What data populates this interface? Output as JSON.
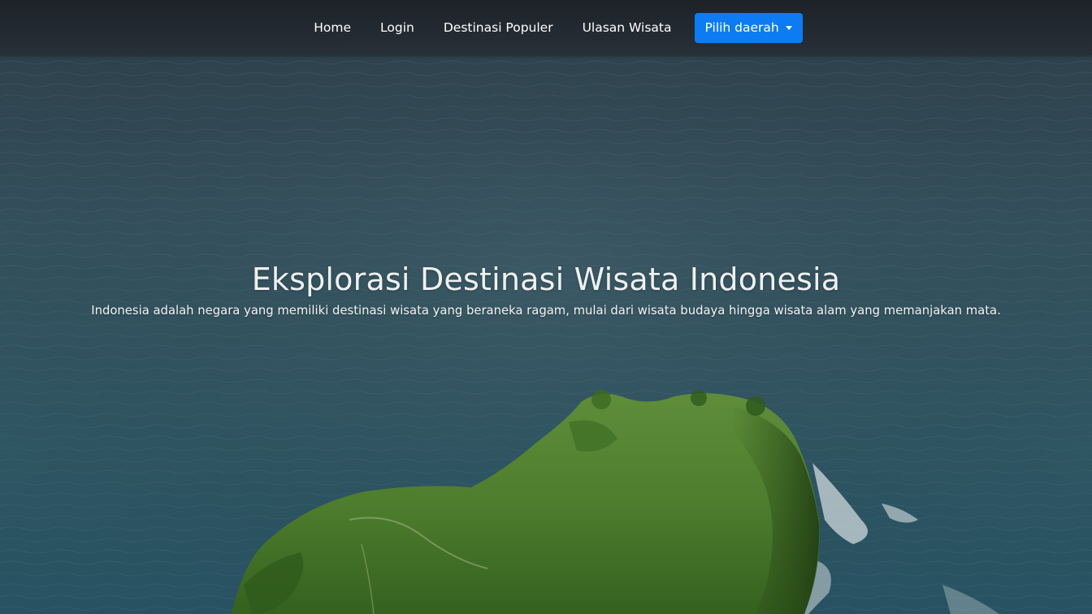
{
  "nav": {
    "items": [
      {
        "label": "Home"
      },
      {
        "label": "Login"
      },
      {
        "label": "Destinasi Populer"
      },
      {
        "label": "Ulasan Wisata"
      }
    ],
    "dropdown_label": "Pilih daerah",
    "dropdown_icon": "caret-down-icon"
  },
  "hero": {
    "title": "Eksplorasi Destinasi Wisata Indonesia",
    "subtitle": "Indonesia adalah negara yang memiliki destinasi wisata yang beraneka ragam, mulai dari wisata budaya hingga wisata alam yang memanjakan mata."
  },
  "colors": {
    "accent": "#0d7cf2",
    "navbar": "#1e232a",
    "sea": "#37535f",
    "island": "#4a7a2e"
  }
}
